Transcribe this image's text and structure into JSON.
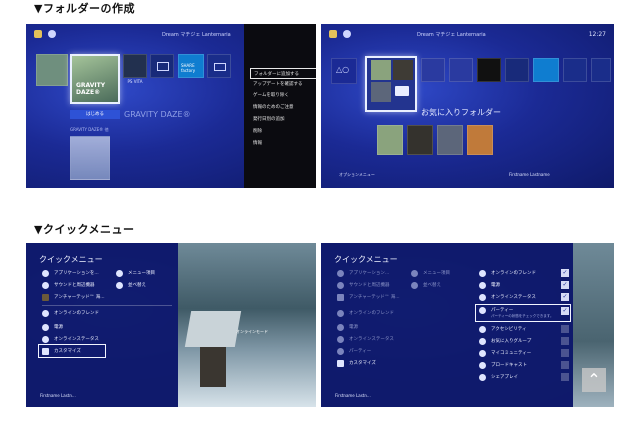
{
  "sections": {
    "folder_title": "▼フォルダーの作成",
    "quick_title": "▼クイックメニュー"
  },
  "panel1": {
    "top_text": "Dream マチジェ Lanternaria",
    "game_title": "GRAVITY DAZE®",
    "play_label": "はじめる",
    "sub_caption": "GRAVITY DAZE® 他",
    "context_menu": [
      "フォルダーに追加する",
      "アップデートを確認する",
      "ゲームを取り除く",
      "情報のためのご注意",
      "発行日別の追加",
      "削除",
      "情報"
    ],
    "tile_labels": [
      "PS VITA",
      "",
      "SHARE factory"
    ]
  },
  "panel2": {
    "clock": "12:27",
    "top_text": "Dream マチジェ Lanternaria",
    "folder_label": "お気に入りフォルダー",
    "options_label": "オプションメニュー",
    "user_label": "Firstname Lastname"
  },
  "panel3": {
    "title": "クイックメニュー",
    "left_items": [
      "アプリケーションを...",
      "サウンドと周辺機器",
      "アンチャーテッド™ 海...",
      "オンラインのフレンド",
      "電源",
      "オンラインステータス",
      "カスタマイズ"
    ],
    "right_items": [
      "メニュー項目",
      "並べ替え"
    ],
    "user_label": "Firstname Lastn...",
    "scene_caption": "オンラインモード"
  },
  "panel4": {
    "title": "クイックメニュー",
    "left_items": [
      "アプリケーション...",
      "サウンドと周辺機器",
      "アンチャーテッド™ 海...",
      "オンラインのフレンド",
      "電源",
      "オンラインステータス",
      "パーティー",
      "カスタマイズ"
    ],
    "mid_items": [
      "メニュー項目",
      "並べ替え"
    ],
    "right_items": [
      "オンラインのフレンド",
      "電源",
      "オンラインステータス",
      "パーティー",
      "アクセシビリティ",
      "お気に入りグループ",
      "マイコミュニティー",
      "ブロードキャスト",
      "シェアプレイ"
    ],
    "party_sub": "パーティーの状態をチェックできます。",
    "user_label": "Firstname Lastn...",
    "scroll_top_glyph": "⌃"
  },
  "colors": {
    "ps_blue": "#1b2a95",
    "ps_blue_light": "#2f49c8",
    "menu_black": "#0b0b10"
  }
}
